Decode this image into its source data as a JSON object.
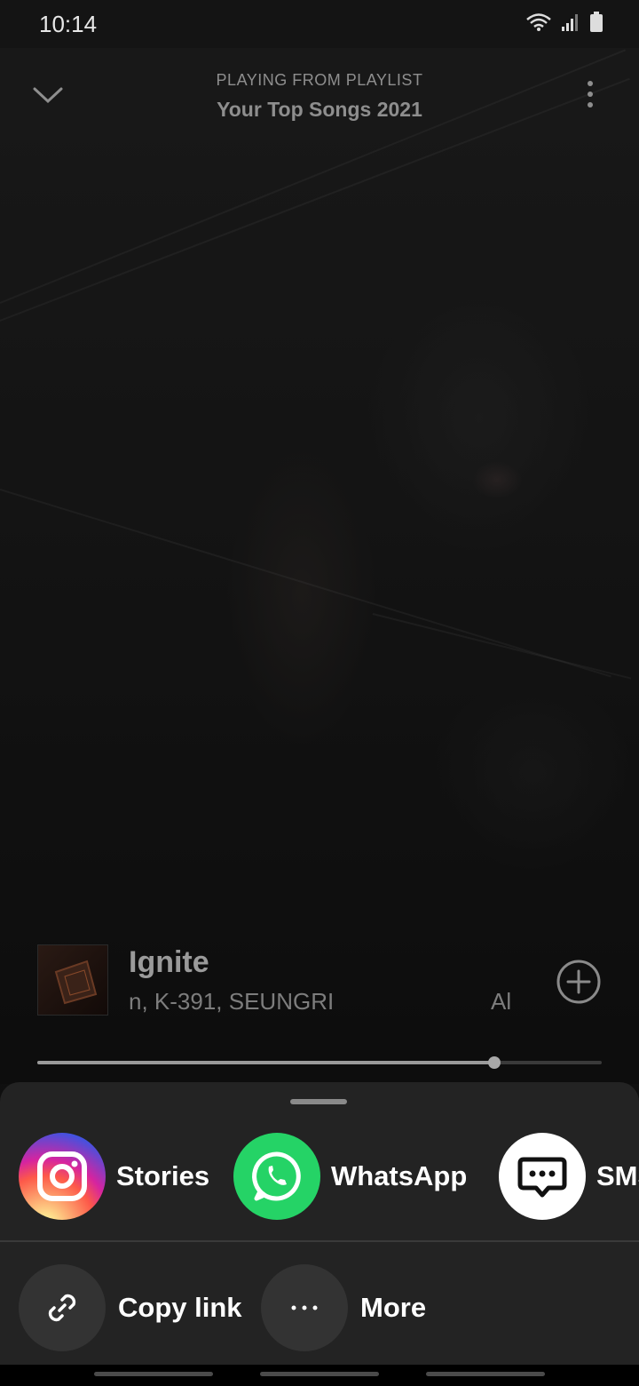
{
  "status_bar": {
    "time": "10:14",
    "icons": [
      "wifi-icon",
      "signal-icon",
      "battery-icon"
    ]
  },
  "header": {
    "context_label": "PLAYING FROM PLAYLIST",
    "playlist_name": "Your Top Songs 2021",
    "collapse_icon": "chevron-down-icon",
    "menu_icon": "more-vertical-icon"
  },
  "track": {
    "title": "Ignite",
    "artists_visible": "n, K-391, SEUNGRI",
    "artists_tail": "Al",
    "add_icon": "add-circle-icon"
  },
  "playback": {
    "progress": 0.81
  },
  "share_sheet": {
    "targets": [
      {
        "label": "Stories",
        "icon": "instagram-icon"
      },
      {
        "label": "WhatsApp",
        "icon": "whatsapp-icon"
      },
      {
        "label": "SMS",
        "icon": "sms-icon"
      }
    ],
    "actions": [
      {
        "label": "Copy link",
        "icon": "link-icon"
      },
      {
        "label": "More",
        "icon": "more-horizontal-icon"
      }
    ]
  },
  "colors": {
    "whatsapp": "#25d366",
    "sheet_background": "#232323"
  }
}
